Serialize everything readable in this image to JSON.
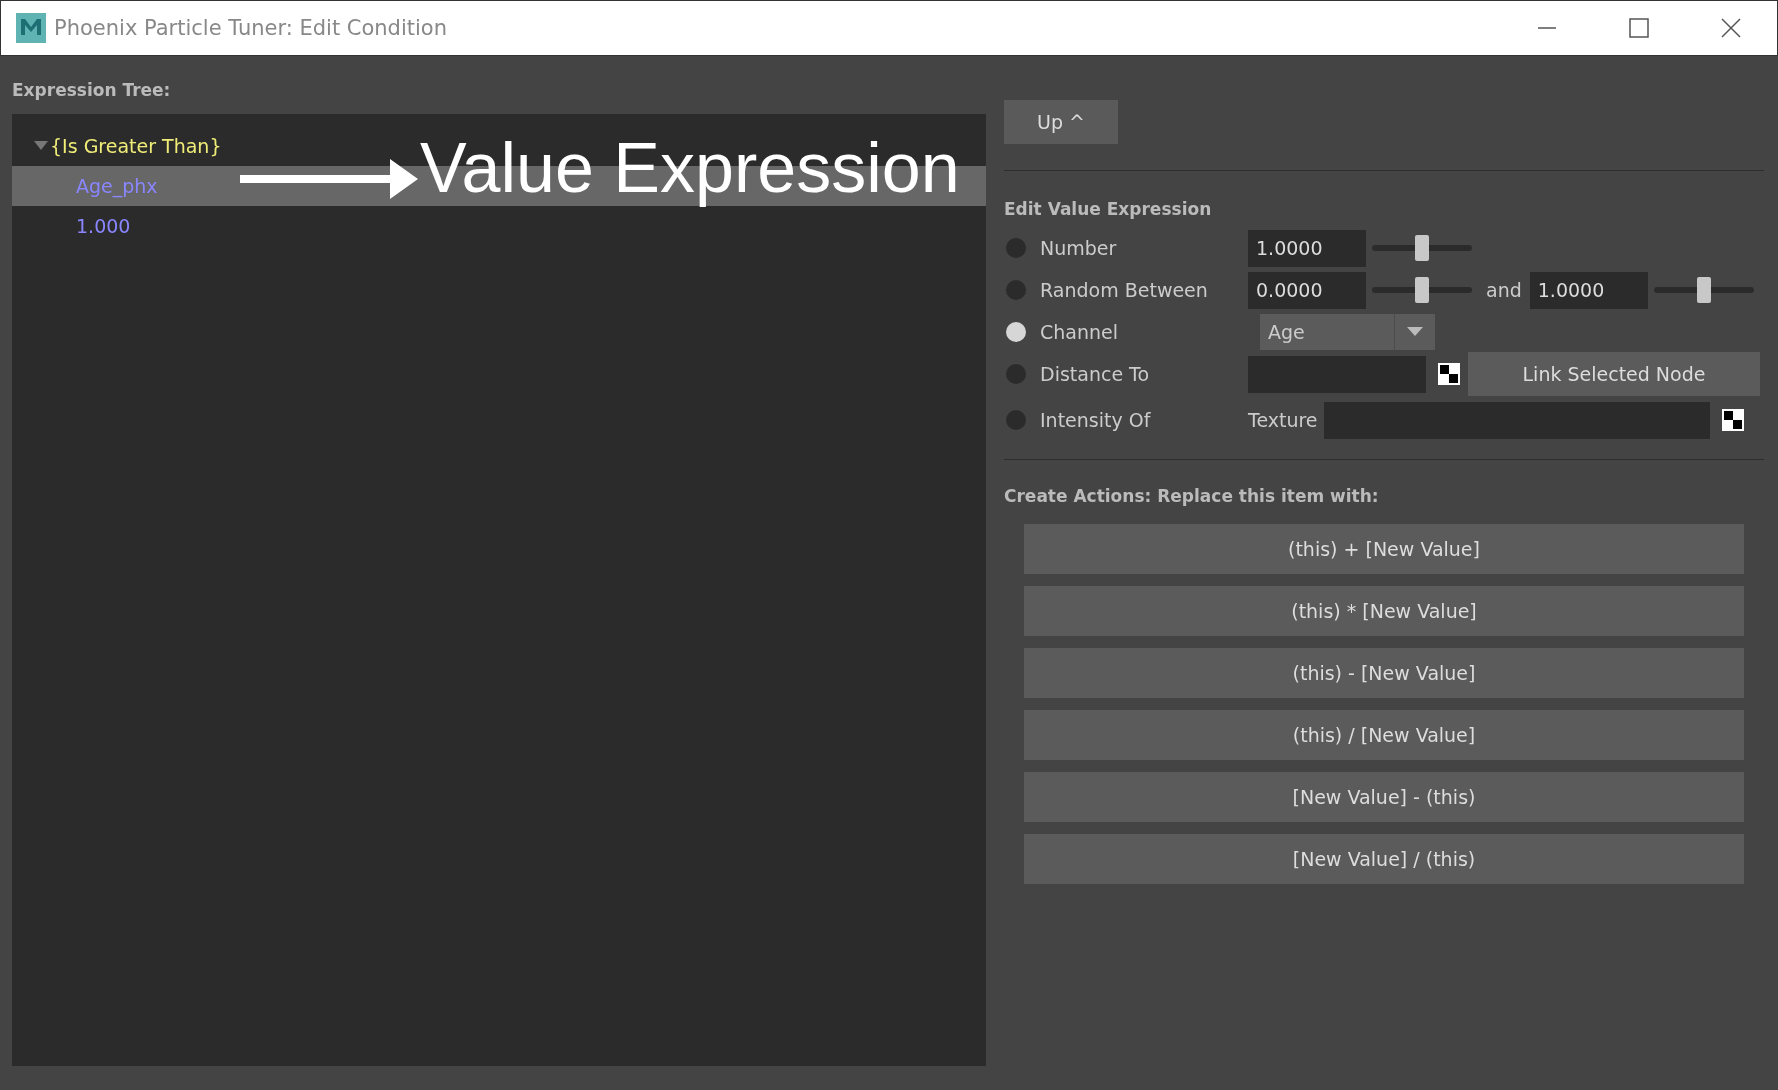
{
  "window": {
    "title": "Phoenix Particle Tuner: Edit Condition"
  },
  "tree": {
    "label": "Expression Tree:",
    "items": [
      {
        "label": "{Is Greater Than}",
        "kind": "operator",
        "expanded": true,
        "selected": false,
        "children": [
          {
            "label": "Age_phx",
            "kind": "value",
            "selected": true
          },
          {
            "label": "1.000",
            "kind": "value",
            "selected": false
          }
        ]
      }
    ]
  },
  "annotation": {
    "text": "Value Expression"
  },
  "up_button": "Up ^",
  "edit": {
    "heading": "Edit Value Expression",
    "options": [
      {
        "kind": "number",
        "label": "Number",
        "selected": false,
        "inputs": [
          {
            "value": "1.0000",
            "level": 0.5
          }
        ]
      },
      {
        "kind": "range",
        "label": "Random Between",
        "selected": false,
        "joiner": "and",
        "inputs": [
          {
            "value": "0.0000",
            "level": 0.5
          },
          {
            "value": "1.0000",
            "level": 0.5
          }
        ]
      },
      {
        "kind": "channel",
        "label": "Channel",
        "selected": true,
        "value": "Age"
      },
      {
        "kind": "node",
        "label": "Distance To",
        "selected": false,
        "button": "Link Selected Node"
      },
      {
        "kind": "texture",
        "label": "Intensity Of",
        "selected": false,
        "sublabel": "Texture"
      }
    ]
  },
  "actions": {
    "heading": "Create Actions: Replace this item with:",
    "buttons": [
      "(this) + [New Value]",
      "(this) * [New Value]",
      "(this) - [New Value]",
      "(this) / [New Value]",
      "[New Value] - (this)",
      "[New Value] / (this)"
    ]
  }
}
